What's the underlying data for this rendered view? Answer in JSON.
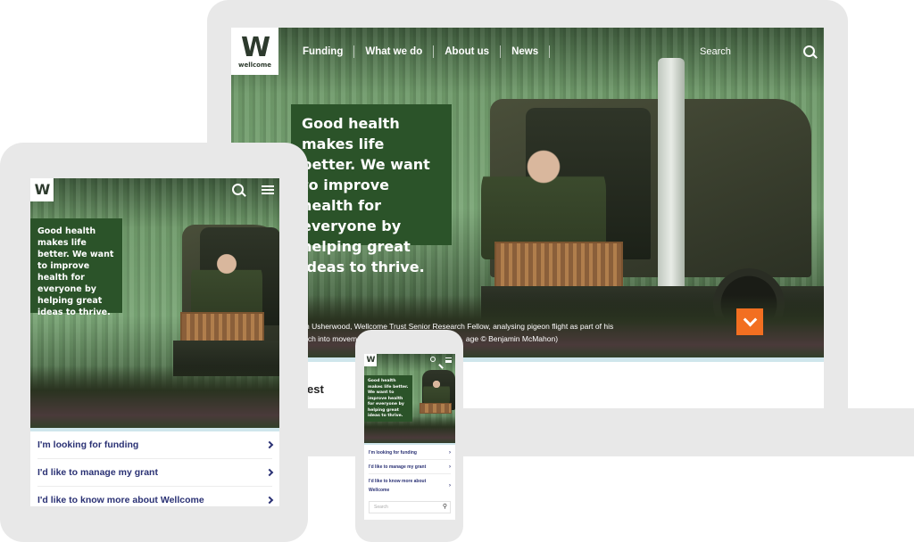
{
  "brand": {
    "logo_letter": "W",
    "logo_text": "wellcome"
  },
  "colors": {
    "headline_bg": "#2b5329",
    "accent": "#f26f21",
    "link": "#2a3174",
    "strip": "#cfe6ec",
    "device": "#e8e8e8"
  },
  "desktop": {
    "nav": [
      {
        "label": "Funding"
      },
      {
        "label": "What we do"
      },
      {
        "label": "About us"
      },
      {
        "label": "News"
      }
    ],
    "search_label": "Search",
    "search_icon": "search-icon",
    "headline": "Good health makes life better. We want to improve health for everyone by helping great ideas to thrive.",
    "caption_line1": "n Usherwood, Wellcome Trust Senior Research Fellow, analysing pigeon flight as part of his",
    "caption_line2": "rch into movement",
    "caption_line2b": "age © Benjamin McMahon)",
    "scroll_icon": "chevron-down-icon",
    "section_title_partial": "est"
  },
  "tablet": {
    "headline": "Good health makes life better. We want to improve health for everyone by helping great ideas to thrive.",
    "links": [
      {
        "label": "I'm looking for funding"
      },
      {
        "label": "I'd like to manage my grant"
      },
      {
        "label": "I'd like to know more about Wellcome"
      }
    ]
  },
  "phone": {
    "headline": "Good health makes life better. We want to improve health for everyone by helping great ideas to thrive.",
    "links": [
      {
        "label": "I'm looking for funding"
      },
      {
        "label": "I'd like to manage my grant"
      },
      {
        "label": "I'd like to know more about Wellcome"
      }
    ],
    "search_placeholder": "Search"
  }
}
